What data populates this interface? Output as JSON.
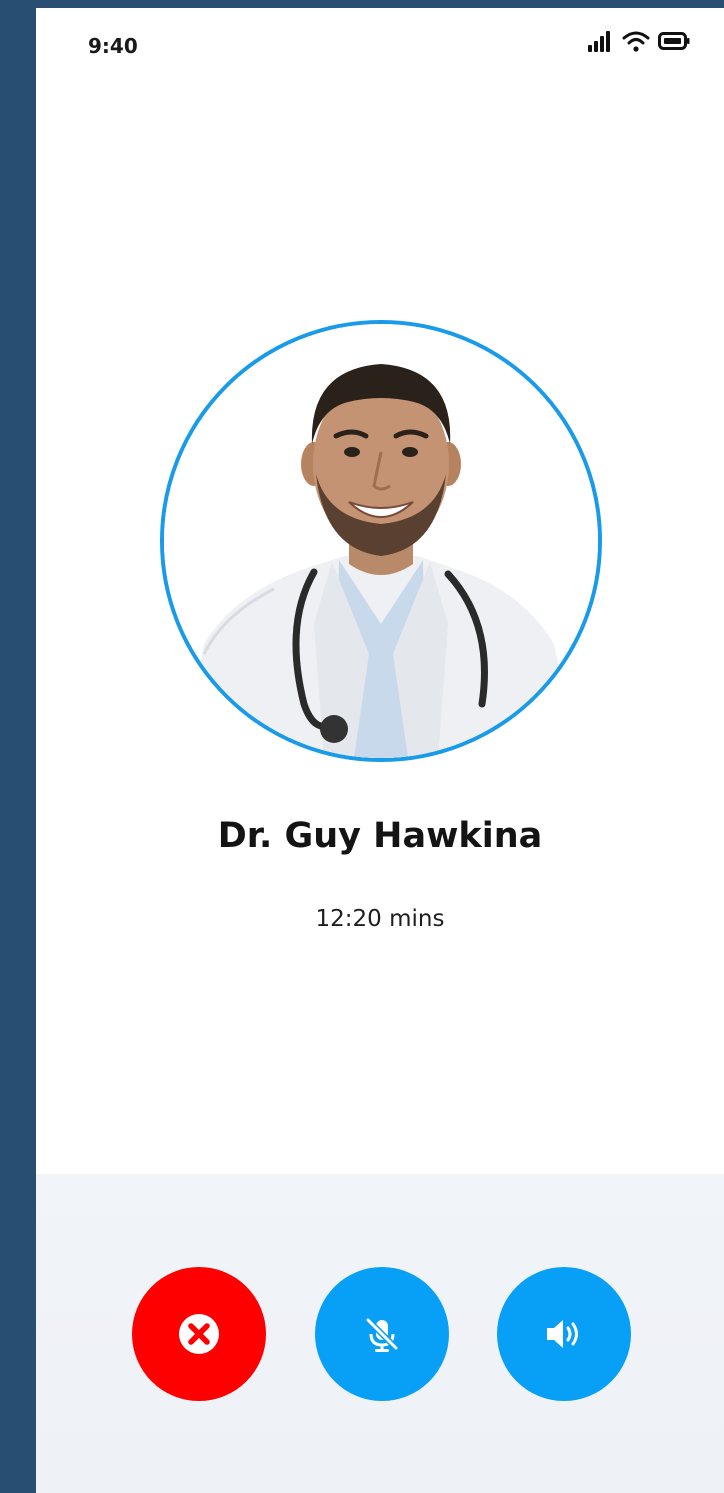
{
  "status_bar": {
    "time": "9:40",
    "icons": [
      "signal-icon",
      "wifi-icon",
      "battery-icon"
    ]
  },
  "call": {
    "doctor_name": "Dr. Guy Hawkina",
    "duration": "12:20 mins"
  },
  "controls": [
    {
      "name": "end-call-button",
      "icon": "close-icon"
    },
    {
      "name": "mute-button",
      "icon": "mic-off-icon"
    },
    {
      "name": "speaker-button",
      "icon": "speaker-icon"
    }
  ],
  "colors": {
    "page_border": "#284e71",
    "accent_blue": "#08a0f7",
    "ring_blue": "#1a9bea",
    "end_red": "#fe0000",
    "panel_bg": "#f1f4f9"
  }
}
